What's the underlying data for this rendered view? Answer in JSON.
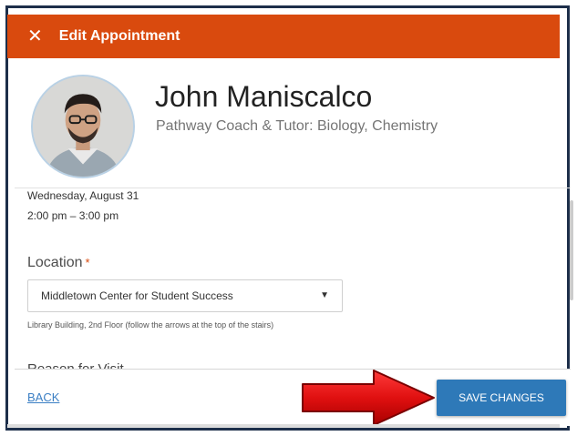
{
  "header": {
    "close_glyph": "✕",
    "title": "Edit Appointment",
    "bg_color": "#d94a0e"
  },
  "profile": {
    "name": "John Maniscalco",
    "role": "Pathway Coach & Tutor: Biology, Chemistry"
  },
  "appointment": {
    "date": "Wednesday, August 31",
    "time": "2:00 pm – 3:00 pm"
  },
  "location": {
    "label": "Location",
    "required_mark": "*",
    "selected": "Middletown Center for Student Success",
    "hint": "Library Building, 2nd Floor (follow the arrows at the top of the stairs)"
  },
  "next_section_label": "Reason for Visit",
  "footer": {
    "back_label": "BACK",
    "save_label": "SAVE CHANGES",
    "save_color": "#2e79b8"
  },
  "icons": {
    "close": "close-icon",
    "dropdown": "chevron-down-icon",
    "annotation": "red-arrow-icon"
  }
}
